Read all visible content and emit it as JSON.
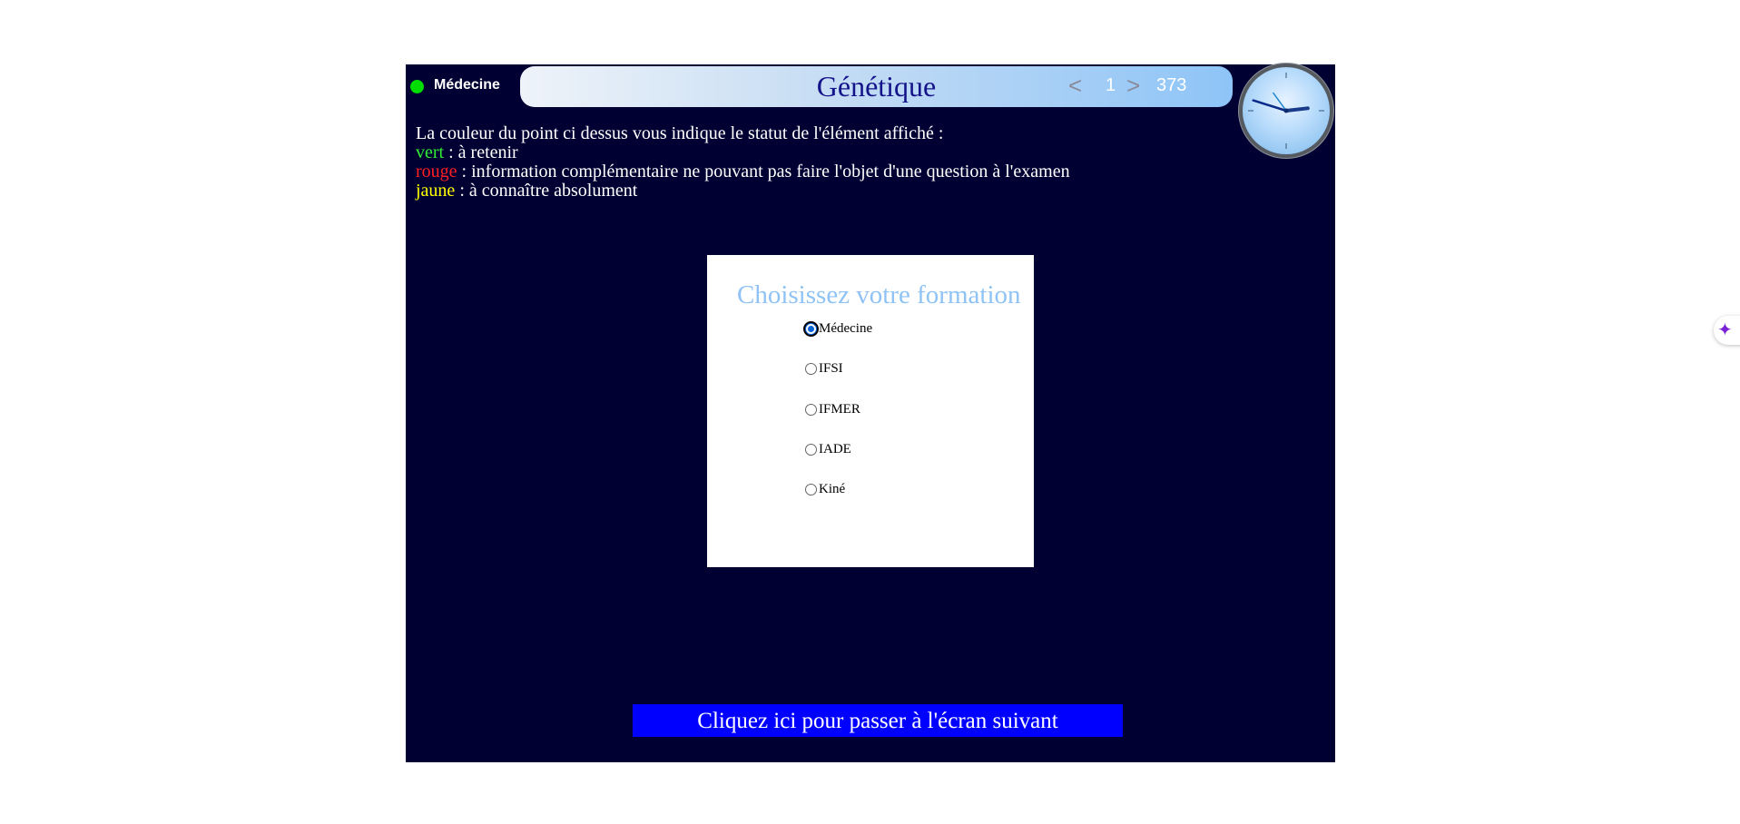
{
  "header": {
    "formation": "Médecine",
    "status_color": "#00dd00",
    "title": "Génétique",
    "nav": {
      "prev_icon": "<",
      "page": "1",
      "next_icon": ">",
      "total": "373"
    }
  },
  "clock": {
    "hour": 2,
    "minute": 47,
    "second": 54
  },
  "legend": {
    "intro": "La couleur du point ci dessus vous indique le statut de l'élément affiché :",
    "items": [
      {
        "color_word": "vert",
        "text": " : à retenir",
        "color": "#33ee33"
      },
      {
        "color_word": "rouge",
        "text": " : information complémentaire ne pouvant pas faire l'objet d'une question à l'examen",
        "color": "#ff2020"
      },
      {
        "color_word": "jaune",
        "text": " : à connaître absolument",
        "color": "#ffff00"
      }
    ]
  },
  "formation_picker": {
    "title": "Choisissez votre formation",
    "selected": "Médecine",
    "options": [
      "Médecine",
      "IFSI",
      "IFMER",
      "IADE",
      "Kiné"
    ]
  },
  "footer": {
    "next_label": "Cliquez ici pour passer à l'écran suivant"
  },
  "colors": {
    "background": "#000033",
    "next_button": "#0000ff",
    "picker_title": "#8fc3f5"
  },
  "extension": {
    "icon": "sparkle-icon",
    "glyph": "✦"
  }
}
